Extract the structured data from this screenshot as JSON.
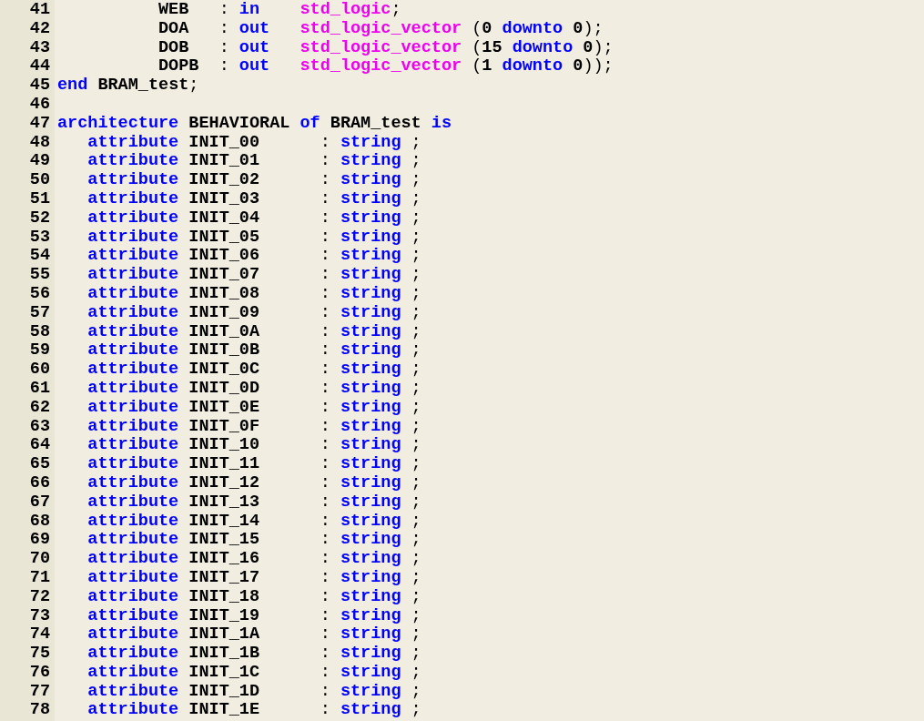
{
  "editor": {
    "lines": [
      {
        "number": "41",
        "tokens": [
          {
            "kind": "text",
            "text": "          WEB   "
          },
          {
            "kind": "punct",
            "text": ":"
          },
          {
            "kind": "keyword",
            "text": " in"
          },
          {
            "kind": "type",
            "text": "    std_logic"
          },
          {
            "kind": "punct",
            "text": ";"
          }
        ]
      },
      {
        "number": "42",
        "tokens": [
          {
            "kind": "text",
            "text": "          DOA   "
          },
          {
            "kind": "punct",
            "text": ":"
          },
          {
            "kind": "keyword",
            "text": " out"
          },
          {
            "kind": "type",
            "text": "   std_logic_vector"
          },
          {
            "kind": "punct",
            "text": " ("
          },
          {
            "kind": "text",
            "text": "0"
          },
          {
            "kind": "keyword",
            "text": " downto"
          },
          {
            "kind": "text",
            "text": " 0"
          },
          {
            "kind": "punct",
            "text": ");"
          }
        ]
      },
      {
        "number": "43",
        "tokens": [
          {
            "kind": "text",
            "text": "          DOB   "
          },
          {
            "kind": "punct",
            "text": ":"
          },
          {
            "kind": "keyword",
            "text": " out"
          },
          {
            "kind": "type",
            "text": "   std_logic_vector"
          },
          {
            "kind": "punct",
            "text": " ("
          },
          {
            "kind": "text",
            "text": "15"
          },
          {
            "kind": "keyword",
            "text": " downto"
          },
          {
            "kind": "text",
            "text": " 0"
          },
          {
            "kind": "punct",
            "text": ");"
          }
        ]
      },
      {
        "number": "44",
        "tokens": [
          {
            "kind": "text",
            "text": "          DOPB  "
          },
          {
            "kind": "punct",
            "text": ":"
          },
          {
            "kind": "keyword",
            "text": " out"
          },
          {
            "kind": "type",
            "text": "   std_logic_vector"
          },
          {
            "kind": "punct",
            "text": " ("
          },
          {
            "kind": "text",
            "text": "1"
          },
          {
            "kind": "keyword",
            "text": " downto"
          },
          {
            "kind": "text",
            "text": " 0"
          },
          {
            "kind": "punct",
            "text": "));"
          }
        ]
      },
      {
        "number": "45",
        "tokens": [
          {
            "kind": "keyword",
            "text": "end"
          },
          {
            "kind": "text",
            "text": " BRAM_test"
          },
          {
            "kind": "punct",
            "text": ";"
          }
        ]
      },
      {
        "number": "46"
      },
      {
        "number": "47",
        "tokens": [
          {
            "kind": "keyword",
            "text": "architecture"
          },
          {
            "kind": "text",
            "text": " BEHAVIORAL"
          },
          {
            "kind": "keyword",
            "text": " of"
          },
          {
            "kind": "text",
            "text": " BRAM_test"
          },
          {
            "kind": "keyword",
            "text": " is"
          }
        ]
      },
      {
        "number": "48",
        "tokens": [
          {
            "kind": "keyword",
            "text": "   attribute"
          },
          {
            "kind": "text",
            "text": " INIT_00      "
          },
          {
            "kind": "punct",
            "text": ":"
          },
          {
            "kind": "keyword",
            "text": " string"
          },
          {
            "kind": "punct",
            "text": " ;"
          }
        ]
      },
      {
        "number": "49",
        "tokens": [
          {
            "kind": "keyword",
            "text": "   attribute"
          },
          {
            "kind": "text",
            "text": " INIT_01      "
          },
          {
            "kind": "punct",
            "text": ":"
          },
          {
            "kind": "keyword",
            "text": " string"
          },
          {
            "kind": "punct",
            "text": " ;"
          }
        ]
      },
      {
        "number": "50",
        "tokens": [
          {
            "kind": "keyword",
            "text": "   attribute"
          },
          {
            "kind": "text",
            "text": " INIT_02      "
          },
          {
            "kind": "punct",
            "text": ":"
          },
          {
            "kind": "keyword",
            "text": " string"
          },
          {
            "kind": "punct",
            "text": " ;"
          }
        ]
      },
      {
        "number": "51",
        "tokens": [
          {
            "kind": "keyword",
            "text": "   attribute"
          },
          {
            "kind": "text",
            "text": " INIT_03      "
          },
          {
            "kind": "punct",
            "text": ":"
          },
          {
            "kind": "keyword",
            "text": " string"
          },
          {
            "kind": "punct",
            "text": " ;"
          }
        ]
      },
      {
        "number": "52",
        "tokens": [
          {
            "kind": "keyword",
            "text": "   attribute"
          },
          {
            "kind": "text",
            "text": " INIT_04      "
          },
          {
            "kind": "punct",
            "text": ":"
          },
          {
            "kind": "keyword",
            "text": " string"
          },
          {
            "kind": "punct",
            "text": " ;"
          }
        ]
      },
      {
        "number": "53",
        "tokens": [
          {
            "kind": "keyword",
            "text": "   attribute"
          },
          {
            "kind": "text",
            "text": " INIT_05      "
          },
          {
            "kind": "punct",
            "text": ":"
          },
          {
            "kind": "keyword",
            "text": " string"
          },
          {
            "kind": "punct",
            "text": " ;"
          }
        ]
      },
      {
        "number": "54",
        "tokens": [
          {
            "kind": "keyword",
            "text": "   attribute"
          },
          {
            "kind": "text",
            "text": " INIT_06      "
          },
          {
            "kind": "punct",
            "text": ":"
          },
          {
            "kind": "keyword",
            "text": " string"
          },
          {
            "kind": "punct",
            "text": " ;"
          }
        ]
      },
      {
        "number": "55",
        "tokens": [
          {
            "kind": "keyword",
            "text": "   attribute"
          },
          {
            "kind": "text",
            "text": " INIT_07      "
          },
          {
            "kind": "punct",
            "text": ":"
          },
          {
            "kind": "keyword",
            "text": " string"
          },
          {
            "kind": "punct",
            "text": " ;"
          }
        ]
      },
      {
        "number": "56",
        "tokens": [
          {
            "kind": "keyword",
            "text": "   attribute"
          },
          {
            "kind": "text",
            "text": " INIT_08      "
          },
          {
            "kind": "punct",
            "text": ":"
          },
          {
            "kind": "keyword",
            "text": " string"
          },
          {
            "kind": "punct",
            "text": " ;"
          }
        ]
      },
      {
        "number": "57",
        "tokens": [
          {
            "kind": "keyword",
            "text": "   attribute"
          },
          {
            "kind": "text",
            "text": " INIT_09      "
          },
          {
            "kind": "punct",
            "text": ":"
          },
          {
            "kind": "keyword",
            "text": " string"
          },
          {
            "kind": "punct",
            "text": " ;"
          }
        ]
      },
      {
        "number": "58",
        "tokens": [
          {
            "kind": "keyword",
            "text": "   attribute"
          },
          {
            "kind": "text",
            "text": " INIT_0A      "
          },
          {
            "kind": "punct",
            "text": ":"
          },
          {
            "kind": "keyword",
            "text": " string"
          },
          {
            "kind": "punct",
            "text": " ;"
          }
        ]
      },
      {
        "number": "59",
        "tokens": [
          {
            "kind": "keyword",
            "text": "   attribute"
          },
          {
            "kind": "text",
            "text": " INIT_0B      "
          },
          {
            "kind": "punct",
            "text": ":"
          },
          {
            "kind": "keyword",
            "text": " string"
          },
          {
            "kind": "punct",
            "text": " ;"
          }
        ]
      },
      {
        "number": "60",
        "tokens": [
          {
            "kind": "keyword",
            "text": "   attribute"
          },
          {
            "kind": "text",
            "text": " INIT_0C      "
          },
          {
            "kind": "punct",
            "text": ":"
          },
          {
            "kind": "keyword",
            "text": " string"
          },
          {
            "kind": "punct",
            "text": " ;"
          }
        ]
      },
      {
        "number": "61",
        "tokens": [
          {
            "kind": "keyword",
            "text": "   attribute"
          },
          {
            "kind": "text",
            "text": " INIT_0D      "
          },
          {
            "kind": "punct",
            "text": ":"
          },
          {
            "kind": "keyword",
            "text": " string"
          },
          {
            "kind": "punct",
            "text": " ;"
          }
        ]
      },
      {
        "number": "62",
        "tokens": [
          {
            "kind": "keyword",
            "text": "   attribute"
          },
          {
            "kind": "text",
            "text": " INIT_0E      "
          },
          {
            "kind": "punct",
            "text": ":"
          },
          {
            "kind": "keyword",
            "text": " string"
          },
          {
            "kind": "punct",
            "text": " ;"
          }
        ]
      },
      {
        "number": "63",
        "tokens": [
          {
            "kind": "keyword",
            "text": "   attribute"
          },
          {
            "kind": "text",
            "text": " INIT_0F      "
          },
          {
            "kind": "punct",
            "text": ":"
          },
          {
            "kind": "keyword",
            "text": " string"
          },
          {
            "kind": "punct",
            "text": " ;"
          }
        ]
      },
      {
        "number": "64",
        "tokens": [
          {
            "kind": "keyword",
            "text": "   attribute"
          },
          {
            "kind": "text",
            "text": " INIT_10      "
          },
          {
            "kind": "punct",
            "text": ":"
          },
          {
            "kind": "keyword",
            "text": " string"
          },
          {
            "kind": "punct",
            "text": " ;"
          }
        ]
      },
      {
        "number": "65",
        "tokens": [
          {
            "kind": "keyword",
            "text": "   attribute"
          },
          {
            "kind": "text",
            "text": " INIT_11      "
          },
          {
            "kind": "punct",
            "text": ":"
          },
          {
            "kind": "keyword",
            "text": " string"
          },
          {
            "kind": "punct",
            "text": " ;"
          }
        ]
      },
      {
        "number": "66",
        "tokens": [
          {
            "kind": "keyword",
            "text": "   attribute"
          },
          {
            "kind": "text",
            "text": " INIT_12      "
          },
          {
            "kind": "punct",
            "text": ":"
          },
          {
            "kind": "keyword",
            "text": " string"
          },
          {
            "kind": "punct",
            "text": " ;"
          }
        ]
      },
      {
        "number": "67",
        "tokens": [
          {
            "kind": "keyword",
            "text": "   attribute"
          },
          {
            "kind": "text",
            "text": " INIT_13      "
          },
          {
            "kind": "punct",
            "text": ":"
          },
          {
            "kind": "keyword",
            "text": " string"
          },
          {
            "kind": "punct",
            "text": " ;"
          }
        ]
      },
      {
        "number": "68",
        "tokens": [
          {
            "kind": "keyword",
            "text": "   attribute"
          },
          {
            "kind": "text",
            "text": " INIT_14      "
          },
          {
            "kind": "punct",
            "text": ":"
          },
          {
            "kind": "keyword",
            "text": " string"
          },
          {
            "kind": "punct",
            "text": " ;"
          }
        ]
      },
      {
        "number": "69",
        "tokens": [
          {
            "kind": "keyword",
            "text": "   attribute"
          },
          {
            "kind": "text",
            "text": " INIT_15      "
          },
          {
            "kind": "punct",
            "text": ":"
          },
          {
            "kind": "keyword",
            "text": " string"
          },
          {
            "kind": "punct",
            "text": " ;"
          }
        ]
      },
      {
        "number": "70",
        "tokens": [
          {
            "kind": "keyword",
            "text": "   attribute"
          },
          {
            "kind": "text",
            "text": " INIT_16      "
          },
          {
            "kind": "punct",
            "text": ":"
          },
          {
            "kind": "keyword",
            "text": " string"
          },
          {
            "kind": "punct",
            "text": " ;"
          }
        ]
      },
      {
        "number": "71",
        "tokens": [
          {
            "kind": "keyword",
            "text": "   attribute"
          },
          {
            "kind": "text",
            "text": " INIT_17      "
          },
          {
            "kind": "punct",
            "text": ":"
          },
          {
            "kind": "keyword",
            "text": " string"
          },
          {
            "kind": "punct",
            "text": " ;"
          }
        ]
      },
      {
        "number": "72",
        "tokens": [
          {
            "kind": "keyword",
            "text": "   attribute"
          },
          {
            "kind": "text",
            "text": " INIT_18      "
          },
          {
            "kind": "punct",
            "text": ":"
          },
          {
            "kind": "keyword",
            "text": " string"
          },
          {
            "kind": "punct",
            "text": " ;"
          }
        ]
      },
      {
        "number": "73",
        "tokens": [
          {
            "kind": "keyword",
            "text": "   attribute"
          },
          {
            "kind": "text",
            "text": " INIT_19      "
          },
          {
            "kind": "punct",
            "text": ":"
          },
          {
            "kind": "keyword",
            "text": " string"
          },
          {
            "kind": "punct",
            "text": " ;"
          }
        ]
      },
      {
        "number": "74",
        "tokens": [
          {
            "kind": "keyword",
            "text": "   attribute"
          },
          {
            "kind": "text",
            "text": " INIT_1A      "
          },
          {
            "kind": "punct",
            "text": ":"
          },
          {
            "kind": "keyword",
            "text": " string"
          },
          {
            "kind": "punct",
            "text": " ;"
          }
        ]
      },
      {
        "number": "75",
        "tokens": [
          {
            "kind": "keyword",
            "text": "   attribute"
          },
          {
            "kind": "text",
            "text": " INIT_1B      "
          },
          {
            "kind": "punct",
            "text": ":"
          },
          {
            "kind": "keyword",
            "text": " string"
          },
          {
            "kind": "punct",
            "text": " ;"
          }
        ]
      },
      {
        "number": "76",
        "tokens": [
          {
            "kind": "keyword",
            "text": "   attribute"
          },
          {
            "kind": "text",
            "text": " INIT_1C      "
          },
          {
            "kind": "punct",
            "text": ":"
          },
          {
            "kind": "keyword",
            "text": " string"
          },
          {
            "kind": "punct",
            "text": " ;"
          }
        ]
      },
      {
        "number": "77",
        "tokens": [
          {
            "kind": "keyword",
            "text": "   attribute"
          },
          {
            "kind": "text",
            "text": " INIT_1D      "
          },
          {
            "kind": "punct",
            "text": ":"
          },
          {
            "kind": "keyword",
            "text": " string"
          },
          {
            "kind": "punct",
            "text": " ;"
          }
        ]
      },
      {
        "number": "78",
        "tokens": [
          {
            "kind": "keyword",
            "text": "   attribute"
          },
          {
            "kind": "text",
            "text": " INIT_1E      "
          },
          {
            "kind": "punct",
            "text": ":"
          },
          {
            "kind": "keyword",
            "text": " string"
          },
          {
            "kind": "punct",
            "text": " ;"
          }
        ]
      }
    ]
  }
}
